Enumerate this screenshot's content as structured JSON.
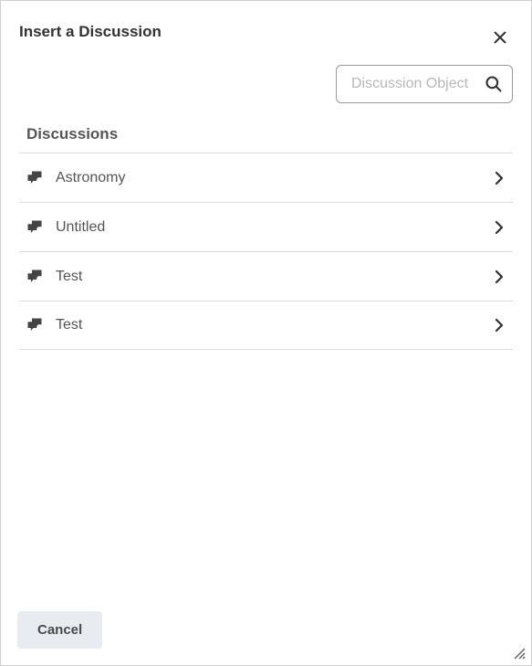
{
  "header": {
    "title": "Insert a Discussion"
  },
  "search": {
    "placeholder": "Discussion Object"
  },
  "section": {
    "heading": "Discussions"
  },
  "items": [
    {
      "label": "Astronomy"
    },
    {
      "label": "Untitled"
    },
    {
      "label": "Test"
    },
    {
      "label": "Test"
    }
  ],
  "footer": {
    "cancel_label": "Cancel"
  }
}
